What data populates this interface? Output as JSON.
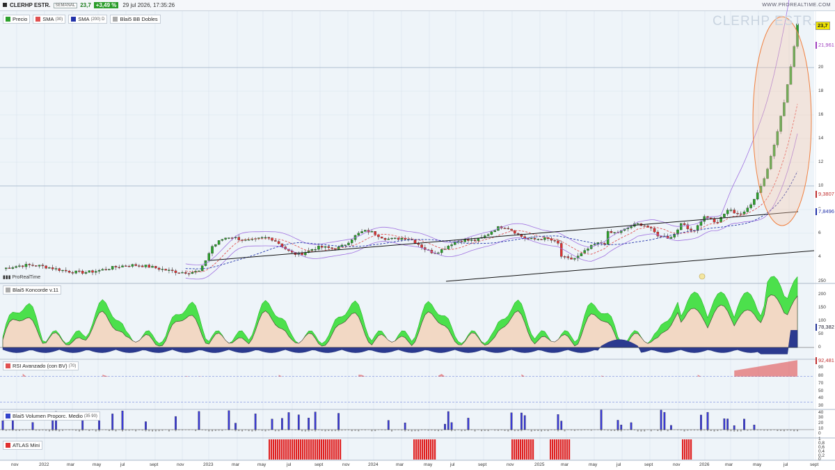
{
  "header": {
    "symbol": "CLERHP ESTR.",
    "timeframe": "SEMANAL",
    "price": "23,7",
    "change": "+3,49 %",
    "datetime": "29 jul 2026, 17:35:26",
    "brand": "WWW.PROREALTIME.COM"
  },
  "watermark": "CLERHP ESTR.",
  "price_panel": {
    "legend": [
      {
        "label": "Precio",
        "color": "#2ca02c"
      },
      {
        "label": "SMA",
        "sup": "(30)",
        "color": "#e05050"
      },
      {
        "label": "SMA",
        "sup": "(200) D",
        "color": "#2233aa"
      },
      {
        "label": "Blai5 BB Dobles",
        "color": "#999999"
      }
    ],
    "y_ticks": [
      "20",
      "18",
      "16",
      "14",
      "12",
      "10",
      "8",
      "6",
      "4"
    ],
    "badges": [
      {
        "text": "23,7",
        "color": "#222",
        "bg": "#f2e600"
      },
      {
        "text": "21,961",
        "color": "#a040c0",
        "bg": "#ffffff"
      },
      {
        "text": "9,3807",
        "color": "#c03030",
        "bg": "#ffffff"
      },
      {
        "text": "7,8496",
        "color": "#2233aa",
        "bg": "#ffffff"
      }
    ],
    "footer_brand": "ProRealTime"
  },
  "koncorde": {
    "title": "Blai5 Koncorde v.11",
    "y_ticks": [
      "250",
      "200",
      "150",
      "100",
      "50",
      "0"
    ],
    "badge": "78,382"
  },
  "rsi": {
    "title": "RSI Avanzado (con BV)",
    "sup": "(70)",
    "y_ticks": [
      "90",
      "80",
      "70",
      "60",
      "50",
      "40",
      "30"
    ],
    "badge": "92,481"
  },
  "volume": {
    "title": "Blai5 Volumen Proporc. Medio",
    "sup": "(35 90)",
    "y_ticks": [
      "40",
      "30",
      "20",
      "10",
      "0"
    ]
  },
  "atlas": {
    "title": "ATLAS Mini",
    "y_ticks": [
      "1",
      "0,8",
      "0,6",
      "0,4",
      "0,2",
      "0"
    ]
  },
  "x_axis": {
    "labels": [
      "nov",
      "2022",
      "mar",
      "may",
      "jul",
      "sept",
      "nov",
      "2023",
      "mar",
      "may",
      "jul",
      "sept",
      "nov",
      "2024",
      "mar",
      "may",
      "jul",
      "sept",
      "nov",
      "2025",
      "mar",
      "may",
      "jul",
      "sept",
      "nov",
      "2026",
      "mar",
      "may",
      "jul",
      "sept"
    ]
  },
  "colors": {
    "up": "#2ca02c",
    "down": "#d33",
    "sma30": "#e05050",
    "sma200": "#2233aa",
    "bb": "#a070e0",
    "ellipse": "#f0a070"
  }
}
